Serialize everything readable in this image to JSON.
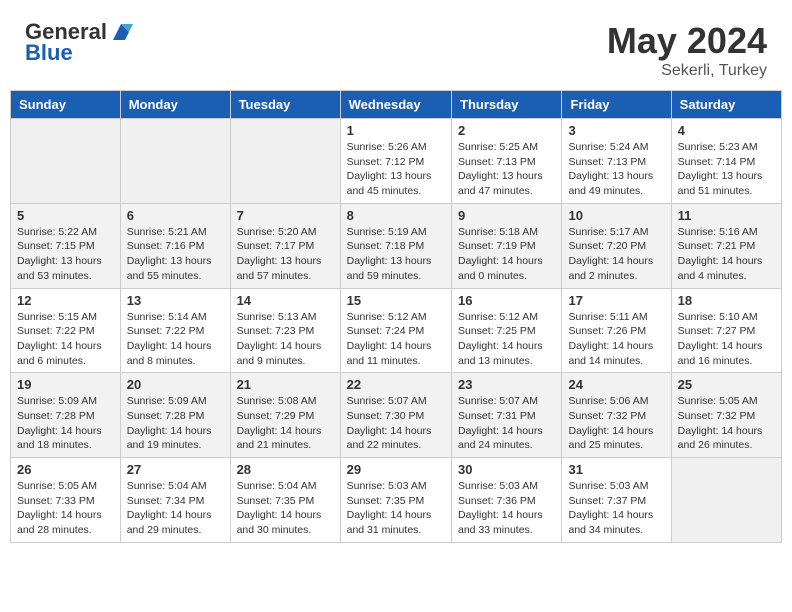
{
  "header": {
    "logo_line1": "General",
    "logo_line2": "Blue",
    "month": "May 2024",
    "location": "Sekerli, Turkey"
  },
  "days_of_week": [
    "Sunday",
    "Monday",
    "Tuesday",
    "Wednesday",
    "Thursday",
    "Friday",
    "Saturday"
  ],
  "weeks": [
    [
      {
        "day": "",
        "info": ""
      },
      {
        "day": "",
        "info": ""
      },
      {
        "day": "",
        "info": ""
      },
      {
        "day": "1",
        "info": "Sunrise: 5:26 AM\nSunset: 7:12 PM\nDaylight: 13 hours\nand 45 minutes."
      },
      {
        "day": "2",
        "info": "Sunrise: 5:25 AM\nSunset: 7:13 PM\nDaylight: 13 hours\nand 47 minutes."
      },
      {
        "day": "3",
        "info": "Sunrise: 5:24 AM\nSunset: 7:13 PM\nDaylight: 13 hours\nand 49 minutes."
      },
      {
        "day": "4",
        "info": "Sunrise: 5:23 AM\nSunset: 7:14 PM\nDaylight: 13 hours\nand 51 minutes."
      }
    ],
    [
      {
        "day": "5",
        "info": "Sunrise: 5:22 AM\nSunset: 7:15 PM\nDaylight: 13 hours\nand 53 minutes."
      },
      {
        "day": "6",
        "info": "Sunrise: 5:21 AM\nSunset: 7:16 PM\nDaylight: 13 hours\nand 55 minutes."
      },
      {
        "day": "7",
        "info": "Sunrise: 5:20 AM\nSunset: 7:17 PM\nDaylight: 13 hours\nand 57 minutes."
      },
      {
        "day": "8",
        "info": "Sunrise: 5:19 AM\nSunset: 7:18 PM\nDaylight: 13 hours\nand 59 minutes."
      },
      {
        "day": "9",
        "info": "Sunrise: 5:18 AM\nSunset: 7:19 PM\nDaylight: 14 hours\nand 0 minutes."
      },
      {
        "day": "10",
        "info": "Sunrise: 5:17 AM\nSunset: 7:20 PM\nDaylight: 14 hours\nand 2 minutes."
      },
      {
        "day": "11",
        "info": "Sunrise: 5:16 AM\nSunset: 7:21 PM\nDaylight: 14 hours\nand 4 minutes."
      }
    ],
    [
      {
        "day": "12",
        "info": "Sunrise: 5:15 AM\nSunset: 7:22 PM\nDaylight: 14 hours\nand 6 minutes."
      },
      {
        "day": "13",
        "info": "Sunrise: 5:14 AM\nSunset: 7:22 PM\nDaylight: 14 hours\nand 8 minutes."
      },
      {
        "day": "14",
        "info": "Sunrise: 5:13 AM\nSunset: 7:23 PM\nDaylight: 14 hours\nand 9 minutes."
      },
      {
        "day": "15",
        "info": "Sunrise: 5:12 AM\nSunset: 7:24 PM\nDaylight: 14 hours\nand 11 minutes."
      },
      {
        "day": "16",
        "info": "Sunrise: 5:12 AM\nSunset: 7:25 PM\nDaylight: 14 hours\nand 13 minutes."
      },
      {
        "day": "17",
        "info": "Sunrise: 5:11 AM\nSunset: 7:26 PM\nDaylight: 14 hours\nand 14 minutes."
      },
      {
        "day": "18",
        "info": "Sunrise: 5:10 AM\nSunset: 7:27 PM\nDaylight: 14 hours\nand 16 minutes."
      }
    ],
    [
      {
        "day": "19",
        "info": "Sunrise: 5:09 AM\nSunset: 7:28 PM\nDaylight: 14 hours\nand 18 minutes."
      },
      {
        "day": "20",
        "info": "Sunrise: 5:09 AM\nSunset: 7:28 PM\nDaylight: 14 hours\nand 19 minutes."
      },
      {
        "day": "21",
        "info": "Sunrise: 5:08 AM\nSunset: 7:29 PM\nDaylight: 14 hours\nand 21 minutes."
      },
      {
        "day": "22",
        "info": "Sunrise: 5:07 AM\nSunset: 7:30 PM\nDaylight: 14 hours\nand 22 minutes."
      },
      {
        "day": "23",
        "info": "Sunrise: 5:07 AM\nSunset: 7:31 PM\nDaylight: 14 hours\nand 24 minutes."
      },
      {
        "day": "24",
        "info": "Sunrise: 5:06 AM\nSunset: 7:32 PM\nDaylight: 14 hours\nand 25 minutes."
      },
      {
        "day": "25",
        "info": "Sunrise: 5:05 AM\nSunset: 7:32 PM\nDaylight: 14 hours\nand 26 minutes."
      }
    ],
    [
      {
        "day": "26",
        "info": "Sunrise: 5:05 AM\nSunset: 7:33 PM\nDaylight: 14 hours\nand 28 minutes."
      },
      {
        "day": "27",
        "info": "Sunrise: 5:04 AM\nSunset: 7:34 PM\nDaylight: 14 hours\nand 29 minutes."
      },
      {
        "day": "28",
        "info": "Sunrise: 5:04 AM\nSunset: 7:35 PM\nDaylight: 14 hours\nand 30 minutes."
      },
      {
        "day": "29",
        "info": "Sunrise: 5:03 AM\nSunset: 7:35 PM\nDaylight: 14 hours\nand 31 minutes."
      },
      {
        "day": "30",
        "info": "Sunrise: 5:03 AM\nSunset: 7:36 PM\nDaylight: 14 hours\nand 33 minutes."
      },
      {
        "day": "31",
        "info": "Sunrise: 5:03 AM\nSunset: 7:37 PM\nDaylight: 14 hours\nand 34 minutes."
      },
      {
        "day": "",
        "info": ""
      }
    ]
  ]
}
